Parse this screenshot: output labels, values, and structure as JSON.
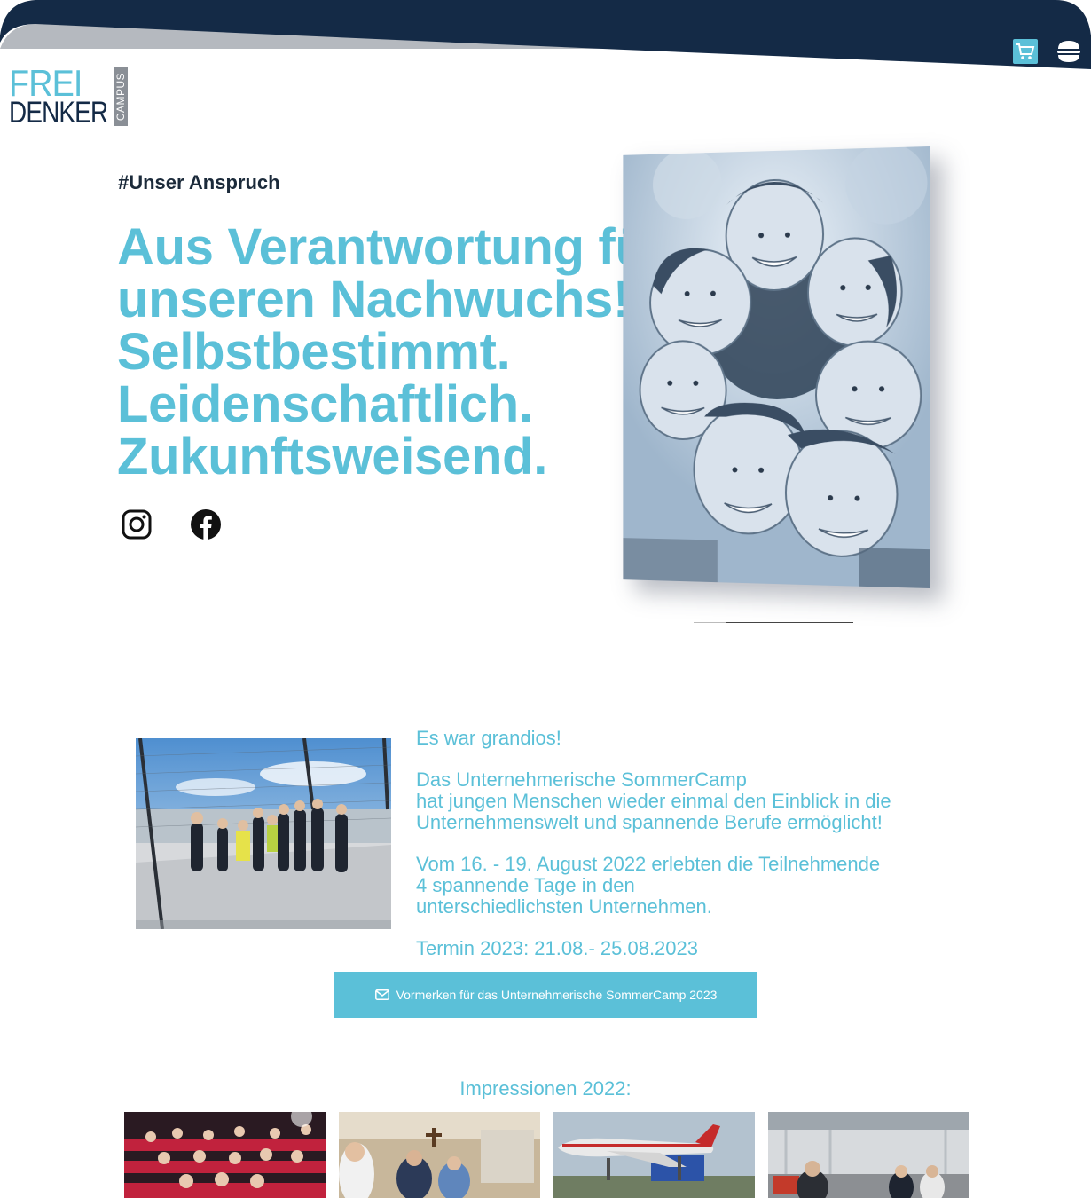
{
  "header": {
    "cart_icon": "cart-icon",
    "menu_icon": "hamburger-menu-icon",
    "colors": {
      "band": "#142a46",
      "accent": "#5bc0d8",
      "grey": "#b5b9bf"
    }
  },
  "logo": {
    "frei": "FREI",
    "denker": "DENKER",
    "campus": "CAMPUS"
  },
  "hero": {
    "eyebrow": "#Unser Anspruch",
    "title_lines": [
      "Aus Verantwortung für",
      "unseren Nachwuchs!",
      "Selbstbestimmt.",
      "Leidenschaftlich.",
      "Zukunftsweisend."
    ],
    "social": [
      "instagram-icon",
      "facebook-icon"
    ]
  },
  "camp": {
    "heading": "Es war grandios!",
    "para1": [
      "Das Unternehmerische SommerCamp",
      "hat jungen Menschen wieder einmal den Einblick in die",
      "Unternehmenswelt und spannende Berufe ermöglicht!"
    ],
    "para2": [
      "Vom 16. - 19. August 2022 erlebten die Teilnehmende",
      "4 spannende Tage in den",
      "unterschiedlichsten Unternehmen."
    ],
    "date": "Termin 2023: 21.08.- 25.08.2023",
    "cta_label": "Vormerken für das Unternehmerische SommerCamp 2023"
  },
  "impressions": {
    "title": "Impressionen 2022:"
  }
}
